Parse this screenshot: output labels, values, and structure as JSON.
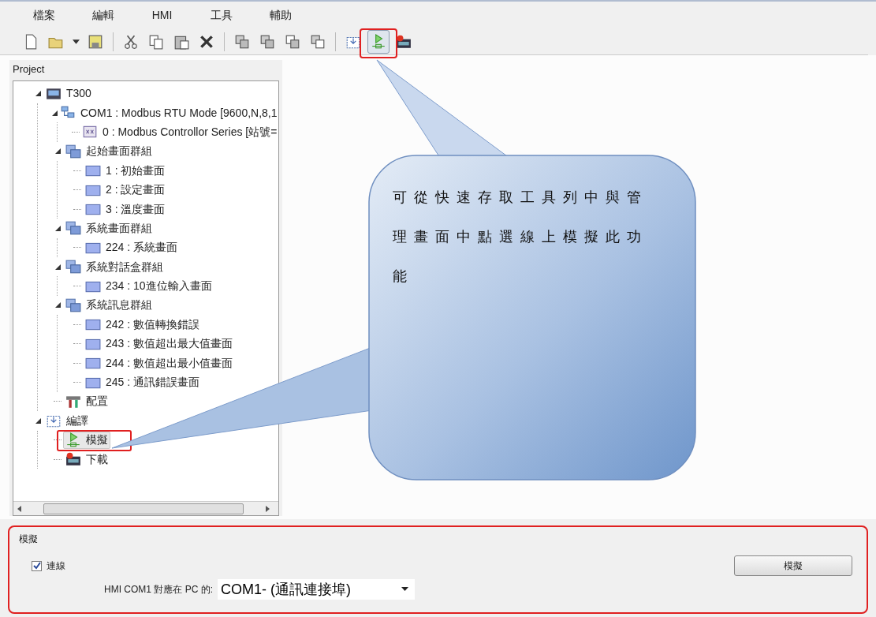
{
  "menu": [
    "檔案",
    "編輯",
    "HMI",
    "工具",
    "輔助"
  ],
  "toolbar": [
    {
      "kind": "new",
      "pressed": false
    },
    {
      "kind": "open",
      "pressed": false
    },
    {
      "kind": "dropdown",
      "pressed": false
    },
    {
      "kind": "save",
      "pressed": false
    },
    {
      "kind": "separator"
    },
    {
      "kind": "cut",
      "pressed": false
    },
    {
      "kind": "copy",
      "pressed": false
    },
    {
      "kind": "paste",
      "pressed": false
    },
    {
      "kind": "delete",
      "pressed": false
    },
    {
      "kind": "separator"
    },
    {
      "kind": "group",
      "pressed": false
    },
    {
      "kind": "ungroup",
      "pressed": false
    },
    {
      "kind": "front",
      "pressed": false
    },
    {
      "kind": "back",
      "pressed": false
    },
    {
      "kind": "separator"
    },
    {
      "kind": "compile",
      "pressed": false
    },
    {
      "kind": "simulate",
      "pressed": true
    },
    {
      "kind": "download",
      "pressed": false
    }
  ],
  "project_panel": {
    "title": "Project",
    "tree": [
      {
        "kind": "device",
        "label": "T300",
        "expanded": true,
        "selected": false,
        "children": [
          {
            "kind": "com",
            "label": "COM1 : Modbus RTU Mode [9600,N,8,1",
            "expanded": true,
            "selected": false,
            "children": [
              {
                "kind": "controller",
                "label": "0 : Modbus Controllor Series [站號=",
                "selected": false
              }
            ]
          },
          {
            "kind": "group",
            "label": "起始畫面群組",
            "expanded": true,
            "selected": false,
            "children": [
              {
                "kind": "screen",
                "label": "1 : 初始畫面",
                "selected": false
              },
              {
                "kind": "screen",
                "label": "2 : 設定畫面",
                "selected": false
              },
              {
                "kind": "screen",
                "label": "3 : 溫度畫面",
                "selected": false
              }
            ]
          },
          {
            "kind": "group",
            "label": "系統畫面群組",
            "expanded": true,
            "selected": false,
            "children": [
              {
                "kind": "screen",
                "label": "224 : 系統畫面",
                "selected": false
              }
            ]
          },
          {
            "kind": "group",
            "label": "系統對話盒群組",
            "expanded": true,
            "selected": false,
            "children": [
              {
                "kind": "screen",
                "label": "234 : 10進位輸入畫面",
                "selected": false
              }
            ]
          },
          {
            "kind": "group",
            "label": "系統訊息群組",
            "expanded": true,
            "selected": false,
            "children": [
              {
                "kind": "screen",
                "label": "242 : 數值轉換錯誤",
                "selected": false
              },
              {
                "kind": "screen",
                "label": "243 : 數值超出最大值畫面",
                "selected": false
              },
              {
                "kind": "screen",
                "label": "244 : 數值超出最小值畫面",
                "selected": false
              },
              {
                "kind": "screen",
                "label": "245 : 通訊錯誤畫面",
                "selected": false
              }
            ]
          },
          {
            "kind": "config",
            "label": "配置",
            "selected": false
          }
        ]
      },
      {
        "kind": "compile",
        "label": "編譯",
        "expanded": true,
        "selected": false,
        "children": [
          {
            "kind": "simulate",
            "label": "模擬",
            "selected": true
          },
          {
            "kind": "download",
            "label": "下載",
            "selected": false
          }
        ]
      }
    ]
  },
  "callout": {
    "text": "可從快速存取工具列中與管理畫面中點選線上模擬此功能"
  },
  "simulation_panel": {
    "title": "模擬",
    "connect": {
      "label": "連線",
      "checked": true
    },
    "port_label": "HMI COM1 對應在 PC 的:",
    "port": {
      "value": "COM1- (通訊連接埠)"
    },
    "button": "模擬"
  }
}
